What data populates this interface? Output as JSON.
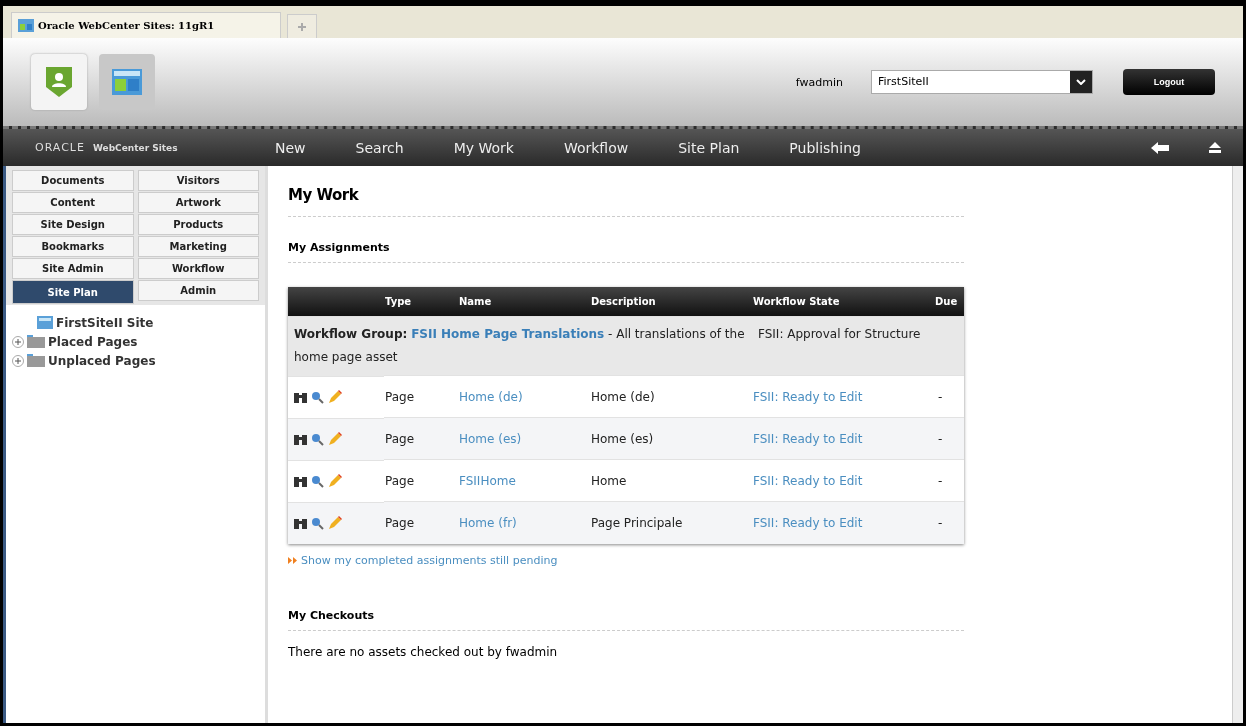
{
  "browser_tab": {
    "title": "Oracle WebCenter Sites: 11gR1"
  },
  "header": {
    "user": "fwadmin",
    "site": "FirstSiteII",
    "logout": "Logout"
  },
  "brand": {
    "logo": "ORACLE",
    "product": "WebCenter Sites"
  },
  "nav": [
    {
      "label": "New"
    },
    {
      "label": "Search"
    },
    {
      "label": "My Work"
    },
    {
      "label": "Workflow"
    },
    {
      "label": "Site Plan"
    },
    {
      "label": "Publishing"
    }
  ],
  "sidebar": {
    "tab_rows": [
      [
        {
          "label": "Documents",
          "selected": false
        },
        {
          "label": "Visitors",
          "selected": false
        }
      ],
      [
        {
          "label": "Content",
          "selected": false
        },
        {
          "label": "Artwork",
          "selected": false
        }
      ],
      [
        {
          "label": "Site Design",
          "selected": false
        },
        {
          "label": "Products",
          "selected": false
        }
      ],
      [
        {
          "label": "Bookmarks",
          "selected": false
        },
        {
          "label": "Marketing",
          "selected": false
        }
      ],
      [
        {
          "label": "Site Admin",
          "selected": false
        },
        {
          "label": "Workflow",
          "selected": false
        }
      ],
      [
        {
          "label": "Site Plan",
          "selected": true
        },
        {
          "label": "Admin",
          "selected": false
        }
      ]
    ],
    "tree": [
      {
        "label": "FirstSiteII Site",
        "kind": "site"
      },
      {
        "label": "Placed Pages",
        "kind": "folder",
        "expanded": false
      },
      {
        "label": "Unplaced Pages",
        "kind": "folder",
        "expanded": false
      }
    ]
  },
  "main": {
    "title": "My Work",
    "assignments_title": "My Assignments",
    "table": {
      "columns": [
        "Type",
        "Name",
        "Description",
        "Workflow State",
        "Due"
      ],
      "group": {
        "label": "Workflow Group:",
        "link": "FSII Home Page Translations",
        "description": " - All translations of the home page asset",
        "state": "FSII: Approval for Structure"
      },
      "rows": [
        {
          "type": "Page",
          "name": "Home (de)",
          "description": "Home (de)",
          "state": "FSII: Ready to Edit",
          "due": "-"
        },
        {
          "type": "Page",
          "name": "Home (es)",
          "description": "Home (es)",
          "state": "FSII: Ready to Edit",
          "due": "-"
        },
        {
          "type": "Page",
          "name": "FSIIHome",
          "description": "Home",
          "state": "FSII: Ready to Edit",
          "due": "-"
        },
        {
          "type": "Page",
          "name": "Home (fr)",
          "description": "Page Principale",
          "state": "FSII: Ready to Edit",
          "due": "-"
        }
      ]
    },
    "show_completed": "Show my completed assignments still pending",
    "checkouts_title": "My Checkouts",
    "checkouts_empty": "There are no assets checked out by fwadmin"
  }
}
